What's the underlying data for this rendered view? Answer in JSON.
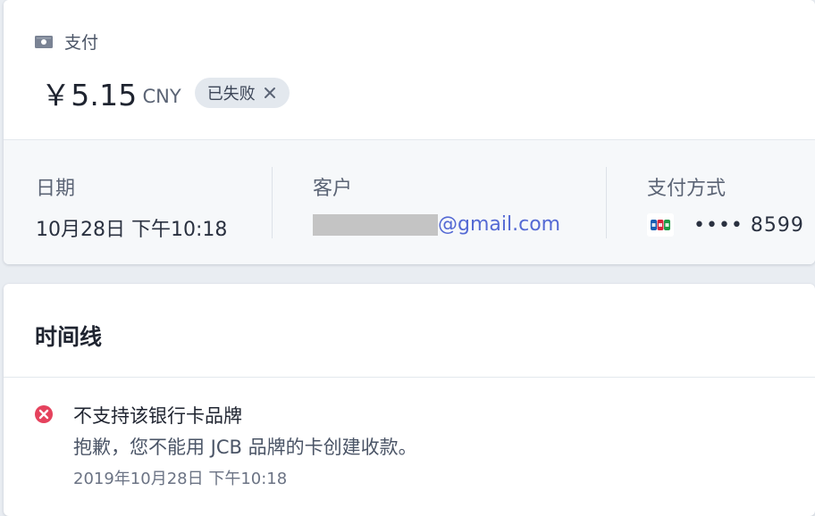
{
  "payment": {
    "section_label": "支付",
    "amount": "￥5.15",
    "currency": "CNY",
    "status": "已失败"
  },
  "details": {
    "date_label": "日期",
    "date_value": "10月28日 下午10:18",
    "customer_label": "客户",
    "customer_email": "@gmail.com",
    "method_label": "支付方式",
    "card_mask": "•••• 8599"
  },
  "timeline": {
    "title": "时间线",
    "events": [
      {
        "title": "不支持该银行卡品牌",
        "description": "抱歉，您不能用 JCB 品牌的卡创建收款。",
        "time": "2019年10月28日 下午10:18"
      }
    ]
  },
  "icons": {
    "payment": "cash-icon",
    "status_close": "close-icon",
    "card_brand": "jcb-card-icon",
    "event_status": "error-icon"
  },
  "colors": {
    "link": "#5469d4",
    "error": "#e5425d",
    "badge_bg": "#e3e8ee"
  }
}
